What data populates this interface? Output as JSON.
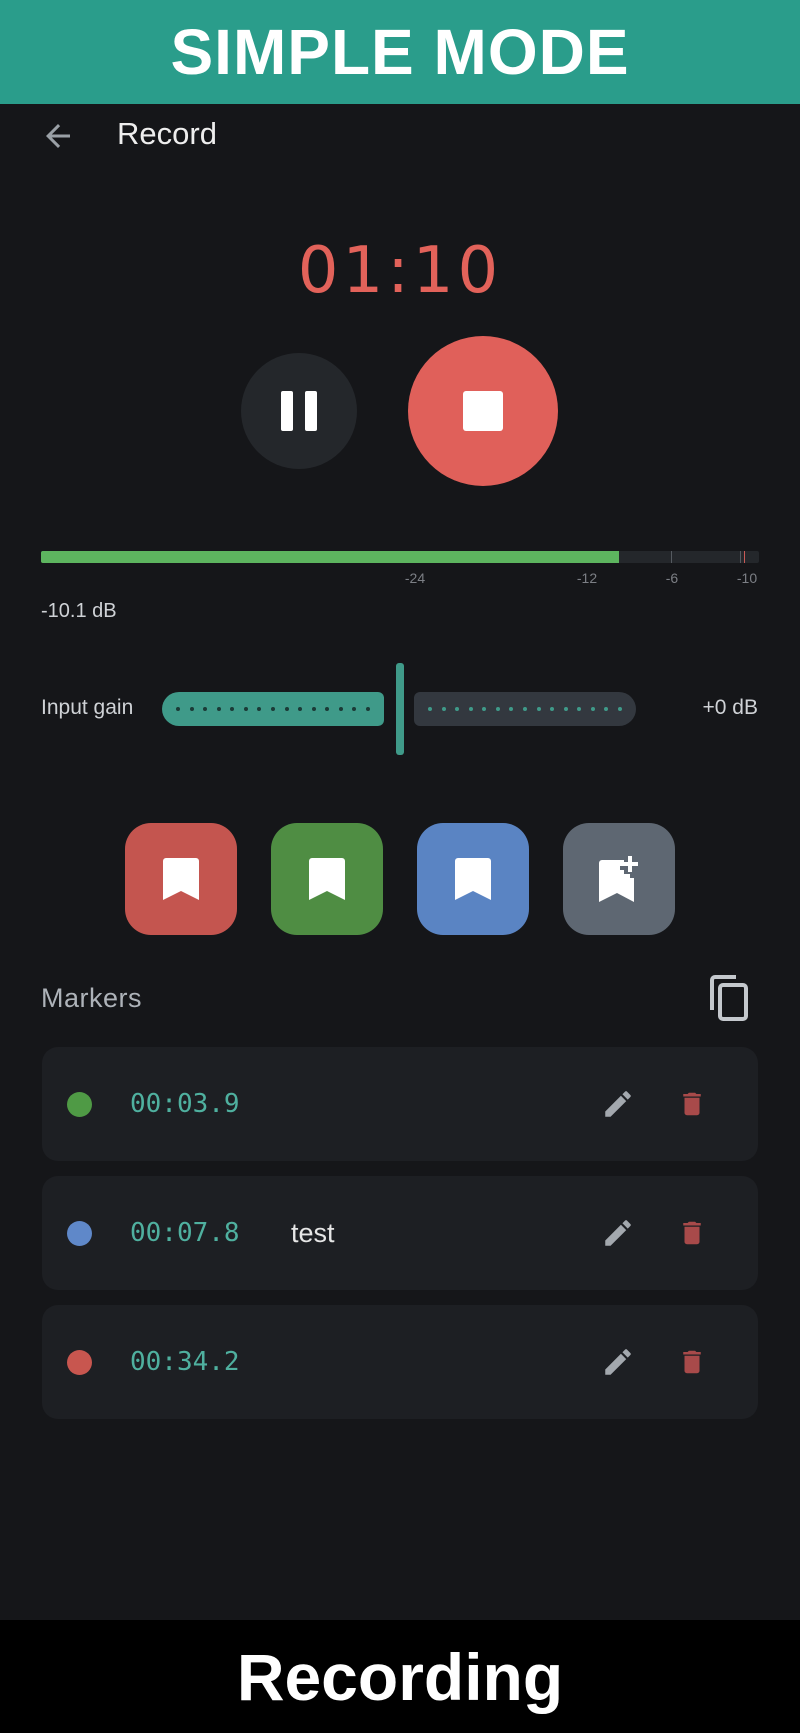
{
  "banner_top": {
    "text": "SIMPLE MODE"
  },
  "appbar": {
    "title": "Record"
  },
  "timer": {
    "elapsed": "01:10"
  },
  "meter": {
    "level_fraction": 0.805,
    "tick_labels": [
      "-24",
      "-12",
      "-6",
      "-10"
    ],
    "readout": "-10.1 dB",
    "fill_color": "#5db55f"
  },
  "gain": {
    "label": "Input gain",
    "value": "+0 dB",
    "accent": "#3f9a89"
  },
  "marker_buttons": [
    {
      "color": "#c4554f",
      "icon": "bookmark-icon"
    },
    {
      "color": "#4f8d43",
      "icon": "bookmark-icon"
    },
    {
      "color": "#5a84c3",
      "icon": "bookmark-icon"
    },
    {
      "color": "#5e6772",
      "icon": "bookmark-add-icon"
    }
  ],
  "markers": {
    "title": "Markers",
    "items": [
      {
        "time": "00:03.9",
        "name": "",
        "color": "#4f9a45"
      },
      {
        "time": "00:07.8",
        "name": "test",
        "color": "#5f88c9"
      },
      {
        "time": "00:34.2",
        "name": "",
        "color": "#c8564f"
      }
    ]
  },
  "banner_bottom": {
    "text": "Recording"
  }
}
